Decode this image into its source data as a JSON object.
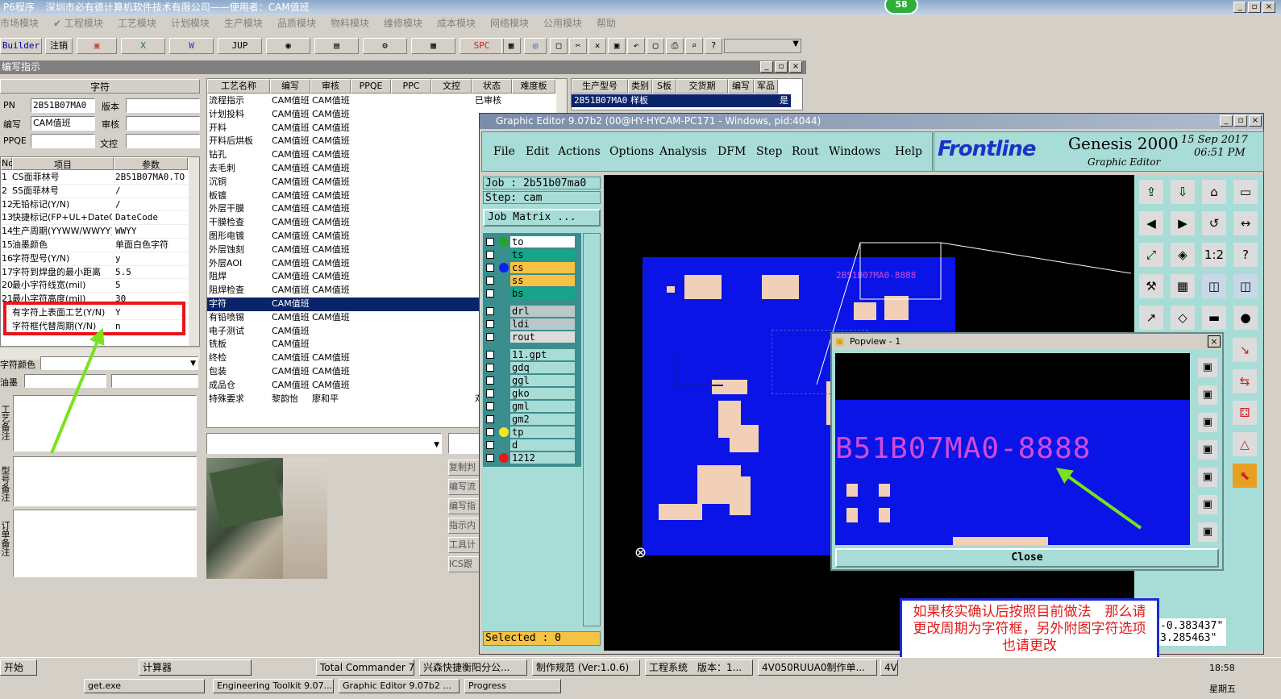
{
  "app": {
    "title": "P6程序",
    "company": "深圳市必有德计算机软件技术有限公司——使用者：CAM值班",
    "badge": "58"
  },
  "menu": [
    "市场模块",
    "✔ 工程模块",
    "工艺模块",
    "计划模块",
    "生产模块",
    "品质模块",
    "物料模块",
    "维修模块",
    "成本模块",
    "网络模块",
    "公用模块",
    "帮助"
  ],
  "toolbar": {
    "builder": "Builder",
    "logout": "注销",
    "jup": "JUP",
    "spc": "SPC"
  },
  "section_title": "编写指示",
  "left_form": {
    "header": "字符",
    "pn_label": "PN",
    "pn_value": "2B51B07MA0",
    "version_label": "版本",
    "writer_label": "编写",
    "writer_value": "CAM值班",
    "review_label": "审核",
    "ppqe_label": "PPQE",
    "wenjiao_label": "文控"
  },
  "param_table": {
    "headers": [
      "No",
      "项目",
      "参数"
    ],
    "rows": [
      {
        "no": "1",
        "item": "CS面菲林号",
        "val": "2B51B07MA0.TO"
      },
      {
        "no": "2",
        "item": "SS面菲林号",
        "val": "/"
      },
      {
        "no": "12",
        "item": "无铅标记(Y/N)",
        "val": "/"
      },
      {
        "no": "13",
        "item": "快捷标记(FP+UL+DateCo",
        "val": "DateCode"
      },
      {
        "no": "14",
        "item": "生产周期(YYWW/WWYY)",
        "val": "WWYY"
      },
      {
        "no": "15",
        "item": "油墨颜色",
        "val": "单面白色字符"
      },
      {
        "no": "16",
        "item": "字符型号(Y/N)",
        "val": "y"
      },
      {
        "no": "17",
        "item": "字符到焊盘的最小距离",
        "val": "5.5"
      },
      {
        "no": "20",
        "item": "最小字符线宽(mil)",
        "val": "5"
      },
      {
        "no": "21",
        "item": "最小字符高度(mil)",
        "val": "30"
      },
      {
        "no": "",
        "item": "有字符上表面工艺(Y/N)",
        "val": "Y"
      },
      {
        "no": "",
        "item": "字符框代替周期(Y/N)",
        "val": "n"
      }
    ]
  },
  "left_fields": {
    "color_label": "字符颜色",
    "ink_label": "油墨"
  },
  "notes_labels": {
    "craft": "工艺备注",
    "model": "型号备注",
    "order": "订单备注"
  },
  "process_table": {
    "headers": [
      "工艺名称",
      "编写",
      "审核",
      "PPQE",
      "PPC",
      "文控",
      "状态",
      "难度板"
    ],
    "rows": [
      {
        "name": "流程指示",
        "w": "CAM值班",
        "r": "CAM值班",
        "s": "已审核"
      },
      {
        "name": "计划投料",
        "w": "CAM值班",
        "r": "CAM值班",
        "s": ""
      },
      {
        "name": "开料",
        "w": "CAM值班",
        "r": "CAM值班",
        "s": ""
      },
      {
        "name": "开料后烘板",
        "w": "CAM值班",
        "r": "CAM值班",
        "s": ""
      },
      {
        "name": "钻孔",
        "w": "CAM值班",
        "r": "CAM值班",
        "s": ""
      },
      {
        "name": "去毛刺",
        "w": "CAM值班",
        "r": "CAM值班",
        "s": ""
      },
      {
        "name": "沉铜",
        "w": "CAM值班",
        "r": "CAM值班",
        "s": ""
      },
      {
        "name": "板镀",
        "w": "CAM值班",
        "r": "CAM值班",
        "s": ""
      },
      {
        "name": "外层干膜",
        "w": "CAM值班",
        "r": "CAM值班",
        "s": ""
      },
      {
        "name": "干膜检查",
        "w": "CAM值班",
        "r": "CAM值班",
        "s": ""
      },
      {
        "name": "图形电镀",
        "w": "CAM值班",
        "r": "CAM值班",
        "s": ""
      },
      {
        "name": "外层蚀刻",
        "w": "CAM值班",
        "r": "CAM值班",
        "s": ""
      },
      {
        "name": "外层AOI",
        "w": "CAM值班",
        "r": "CAM值班",
        "s": ""
      },
      {
        "name": "阻焊",
        "w": "CAM值班",
        "r": "CAM值班",
        "s": ""
      },
      {
        "name": "阻焊检查",
        "w": "CAM值班",
        "r": "CAM值班",
        "s": ""
      },
      {
        "name": "字符",
        "w": "CAM值班",
        "r": "",
        "s": ""
      },
      {
        "name": "有铅喷锡",
        "w": "CAM值班",
        "r": "CAM值班",
        "s": ""
      },
      {
        "name": "电子测试",
        "w": "CAM值班",
        "r": "",
        "s": ""
      },
      {
        "name": "铣板",
        "w": "CAM值班",
        "r": "",
        "s": ""
      },
      {
        "name": "终检",
        "w": "CAM值班",
        "r": "CAM值班",
        "s": ""
      },
      {
        "name": "包装",
        "w": "CAM值班",
        "r": "CAM值班",
        "s": ""
      },
      {
        "name": "成品仓",
        "w": "CAM值班",
        "r": "CAM值班",
        "s": ""
      },
      {
        "name": "特殊要求",
        "w": "黎韵怡",
        "r": "廖和平",
        "s": "邓春兰"
      }
    ]
  },
  "production_table": {
    "headers": [
      "生产型号",
      "类别",
      "S板",
      "交货期",
      "编写",
      "军品"
    ],
    "row": {
      "model": "2B51B07MA0",
      "type": "样板",
      "s": "",
      "date": "",
      "w": "",
      "mil": "是"
    }
  },
  "side_buttons": [
    "复制判",
    "编写流",
    "编写指",
    "指示内",
    "工具计",
    "ICS跟"
  ],
  "graphic_editor": {
    "title": "Graphic Editor 9.07b2 (00@HY-HYCAM-PC171 - Windows, pid:4044)",
    "menu": [
      "File",
      "Edit",
      "Actions",
      "Options",
      "Analysis",
      "DFM",
      "Step",
      "Rout",
      "Windows",
      "Help"
    ],
    "brand": "Frontline",
    "product": "Genesis 2000",
    "subtitle": "Graphic Editor",
    "date": "15 Sep 2017",
    "time": "06:51 PM",
    "job": "Job : 2b51b07ma0",
    "step": "Step: cam",
    "job_matrix": "Job Matrix ...",
    "selected": "Selected : 0",
    "layers": [
      {
        "name": "to",
        "bg": "#ffffff",
        "dot": "#27a327"
      },
      {
        "name": "ts",
        "bg": "#16a48a",
        "dot": ""
      },
      {
        "name": "cs",
        "bg": "#f6c244",
        "dot": "#0a20ee"
      },
      {
        "name": "ss",
        "bg": "#f6c244",
        "dot": ""
      },
      {
        "name": "bs",
        "bg": "#16a48a",
        "dot": ""
      },
      {
        "name": "drl",
        "bg": "#b9c8c8",
        "dot": ""
      },
      {
        "name": "ldi",
        "bg": "#b9c8c8",
        "dot": ""
      },
      {
        "name": "rout",
        "bg": "#dcdcdc",
        "dot": ""
      },
      {
        "name": "11.gpt",
        "bg": "#a8dcd6",
        "dot": ""
      },
      {
        "name": "gdq",
        "bg": "#a8dcd6",
        "dot": ""
      },
      {
        "name": "ggl",
        "bg": "#a8dcd6",
        "dot": ""
      },
      {
        "name": "gko",
        "bg": "#a8dcd6",
        "dot": ""
      },
      {
        "name": "gml",
        "bg": "#a8dcd6",
        "dot": ""
      },
      {
        "name": "gm2",
        "bg": "#a8dcd6",
        "dot": ""
      },
      {
        "name": "tp",
        "bg": "#a8dcd6",
        "dot": "#f4ea1a"
      },
      {
        "name": "d",
        "bg": "#a8dcd6",
        "dot": ""
      },
      {
        "name": "1212",
        "bg": "#a8dcd6",
        "dot": "#e01b1b"
      }
    ],
    "board_label": "2B51B07MA0-8888",
    "coord_x": "-0.383437\"",
    "coord_y": "3.285463\""
  },
  "popview": {
    "title": "Popview - 1",
    "text": "B51B07MA0-8888",
    "close": "Close"
  },
  "annotation": "如果核实确认后按照目前做法　那么请更改周期为字符框，另外附图字符选项也请更改",
  "taskbar": {
    "start": "开始",
    "items": [
      "计算器",
      "Total Commander 7....",
      "兴森快捷衡阳分公...",
      "制作规范 (Ver:1.0.6)",
      "工程系统　版本：1...",
      "4V050RUUA0制作单...",
      "4V"
    ],
    "items2": [
      "get.exe",
      "Engineering Toolkit 9.07...",
      "Graphic Editor 9.07b2 ...",
      "Progress"
    ],
    "clock": "18:58",
    "day": "星期五"
  },
  "colors": {
    "pcb": "#0a14e6",
    "annotation_text": "#e01b1b",
    "annotation_border": "#1a2ad6",
    "arrow": "#7be21e",
    "highlight": "#e8161b"
  }
}
